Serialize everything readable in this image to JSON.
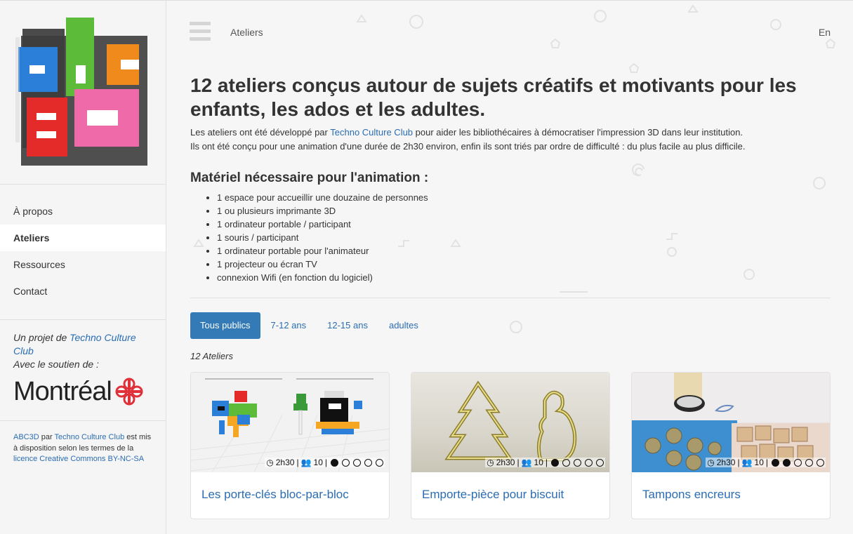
{
  "logo": {
    "alt": "abc3d"
  },
  "nav": {
    "items": [
      {
        "label": "À propos",
        "active": false
      },
      {
        "label": "Ateliers",
        "active": true
      },
      {
        "label": "Ressources",
        "active": false
      },
      {
        "label": "Contact",
        "active": false
      }
    ]
  },
  "sidebar": {
    "project_prefix": "Un projet de",
    "project_link": "Techno Culture Club",
    "support": "Avec le soutien de :",
    "montreal": "Montréal",
    "license_link1": "ABC3D",
    "license_par": "par",
    "license_link2": "Techno Culture Club",
    "license_text": "est mis à disposition selon les termes de la",
    "license_link3": "licence Creative Commons BY-NC-SA"
  },
  "topbar": {
    "breadcrumb": "Ateliers",
    "language": "En"
  },
  "main": {
    "title": "12 ateliers conçus autour de sujets créatifs et motivants pour les enfants, les ados et les adultes.",
    "intro_before": "Les ateliers ont été développé par",
    "intro_link": "Techno Culture Club",
    "intro_after": "pour aider les bibliothécaires à démocratiser l'impression 3D dans leur institution.",
    "intro_line2": "Ils ont été conçu pour une animation d'une durée de 2h30 environ, enfin ils sont triés par ordre de difficulté : du plus facile au plus difficile.",
    "materials_title": "Matériel nécessaire pour l'animation :",
    "materials": [
      "1 espace pour accueillir une douzaine de personnes",
      "1 ou plusieurs imprimante 3D",
      "1 ordinateur portable / participant",
      "1 souris / participant",
      "1 ordinateur portable pour l'animateur",
      "1 projecteur ou écran TV",
      "connexion Wifi (en fonction du logiciel)"
    ],
    "filters": [
      "Tous publics",
      "7-12 ans",
      "12-15 ans",
      "adultes"
    ],
    "count": "12 Ateliers"
  },
  "cards": [
    {
      "title": "Les porte-clés bloc-par-bloc",
      "duration": "2h30",
      "people": "10",
      "difficulty": 1
    },
    {
      "title": "Emporte-pièce pour biscuit",
      "duration": "2h30",
      "people": "10",
      "difficulty": 1
    },
    {
      "title": "Tampons encreurs",
      "duration": "2h30",
      "people": "10",
      "difficulty": 2
    }
  ],
  "colors": {
    "link": "#2a6db3",
    "active_filter": "#337ab7",
    "montreal_red": "#e0303a"
  }
}
